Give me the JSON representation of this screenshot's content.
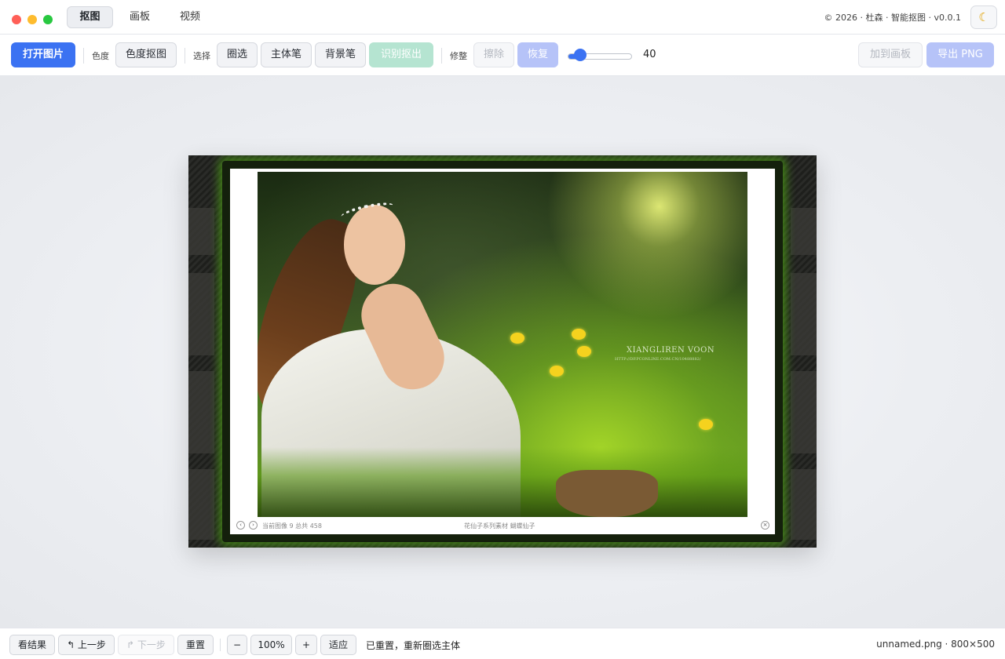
{
  "window": {
    "tabs": [
      {
        "label": "抠图",
        "active": true
      },
      {
        "label": "画板",
        "active": false
      },
      {
        "label": "视频",
        "active": false
      }
    ],
    "copyright": "© 2026 · 杜森 · 智能抠图 · v0.0.1",
    "theme_icon": "moon-icon"
  },
  "toolbar": {
    "open_image": "打开图片",
    "chroma_label": "色度",
    "chroma_key": "色度抠图",
    "select_label": "选择",
    "lasso": "圈选",
    "subject_brush": "主体笔",
    "background_brush": "背景笔",
    "detect_extract": "识别抠出",
    "refine_label": "修整",
    "erase": "擦除",
    "restore": "恢复",
    "brush_size": 40,
    "brush_size_max": 200,
    "add_to_canvas": "加到画板",
    "export_png": "导出 PNG"
  },
  "image": {
    "watermark": "XIANGLIREN VOON",
    "watermark_url": "HTTP://DP.PCONLINE.COM.CN/10488882/",
    "viewer_left_text": "当前图像 9 总共 458",
    "viewer_center_text": "花仙子系列素材 蝴蝶仙子",
    "colors": {
      "frame_glow": "#5aaa14",
      "accent": "#3b72f2"
    }
  },
  "statusbar": {
    "view_result": "看结果",
    "undo": "↰ 上一步",
    "redo": "↱ 下一步",
    "reset": "重置",
    "zoom_out": "−",
    "zoom_level": "100%",
    "zoom_in": "+",
    "fit": "适应",
    "message": "已重置，重新圈选主体",
    "file_info": "unnamed.png · 800×500"
  }
}
